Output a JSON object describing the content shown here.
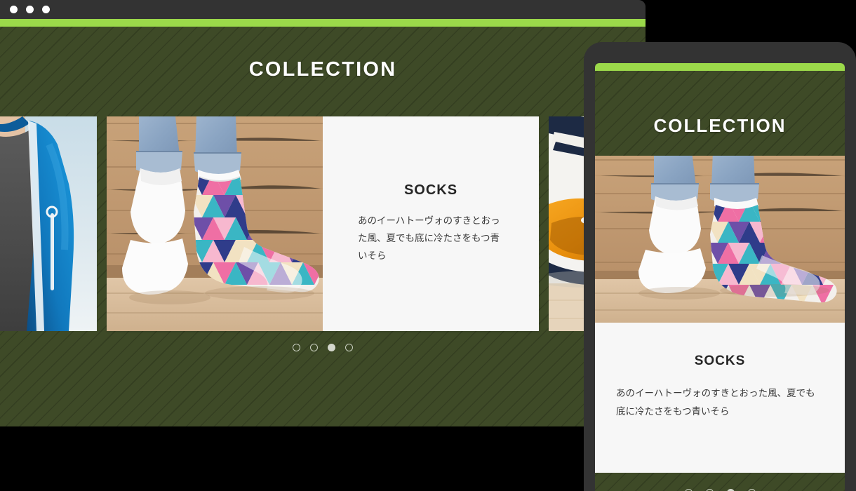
{
  "window_chrome": {
    "traffic_lights": [
      "close-dot",
      "minimize-dot",
      "maximize-dot"
    ],
    "accent_color": "#9bd94a",
    "bar_color": "#333333"
  },
  "theme": {
    "background_green": "#3e4a27",
    "stripe_color": "#33401f",
    "accent_green": "#9bd94a",
    "card_background": "#f7f7f7",
    "title_color": "#262626",
    "heading_color": "#ffffff",
    "dot_inactive": "#c9cfc0",
    "dot_active": "#d4d7cd"
  },
  "desktop": {
    "heading": "COLLECTION",
    "slide": {
      "title": "SOCKS",
      "description": "あのイーハトーヴォのすきとおった風、夏でも底に冷たさをもつ青いそら",
      "image_alt": "patterned-ankle-socks-on-wooden-deck"
    },
    "prev_slide_image_alt": "blue-windbreaker-jacket-over-grey-tshirt",
    "next_slide_image_alt": "orange-cap-on-white-surface",
    "pagination": {
      "total": 4,
      "active_index": 2,
      "dots": [
        "dot-1",
        "dot-2",
        "dot-3",
        "dot-4"
      ]
    }
  },
  "mobile": {
    "heading": "COLLECTION",
    "slide": {
      "title": "SOCKS",
      "description": "あのイーハトーヴォのすきとおった風、夏でも底に冷たさをもつ青いそら",
      "image_alt": "patterned-ankle-socks-on-wooden-deck"
    },
    "pagination": {
      "total": 4,
      "active_index": 2,
      "dots": [
        "dot-1",
        "dot-2",
        "dot-3",
        "dot-4"
      ]
    }
  }
}
